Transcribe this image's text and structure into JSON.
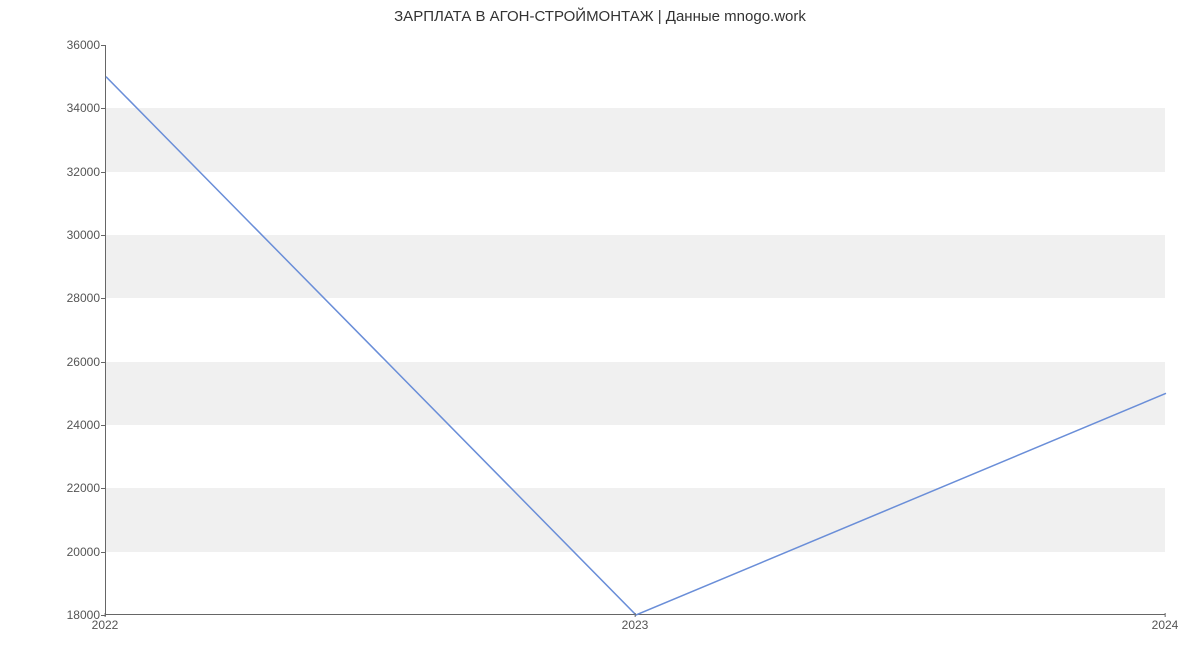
{
  "chart_data": {
    "type": "line",
    "title": "ЗАРПЛАТА В  АГОН-СТРОЙМОНТАЖ | Данные mnogo.work",
    "xlabel": "",
    "ylabel": "",
    "x": [
      "2022",
      "2023",
      "2024"
    ],
    "values": [
      35000,
      18000,
      25000
    ],
    "ylim": [
      18000,
      36000
    ],
    "yticks": [
      18000,
      20000,
      22000,
      24000,
      26000,
      28000,
      30000,
      32000,
      34000,
      36000
    ],
    "line_color": "#6a8ed8"
  }
}
